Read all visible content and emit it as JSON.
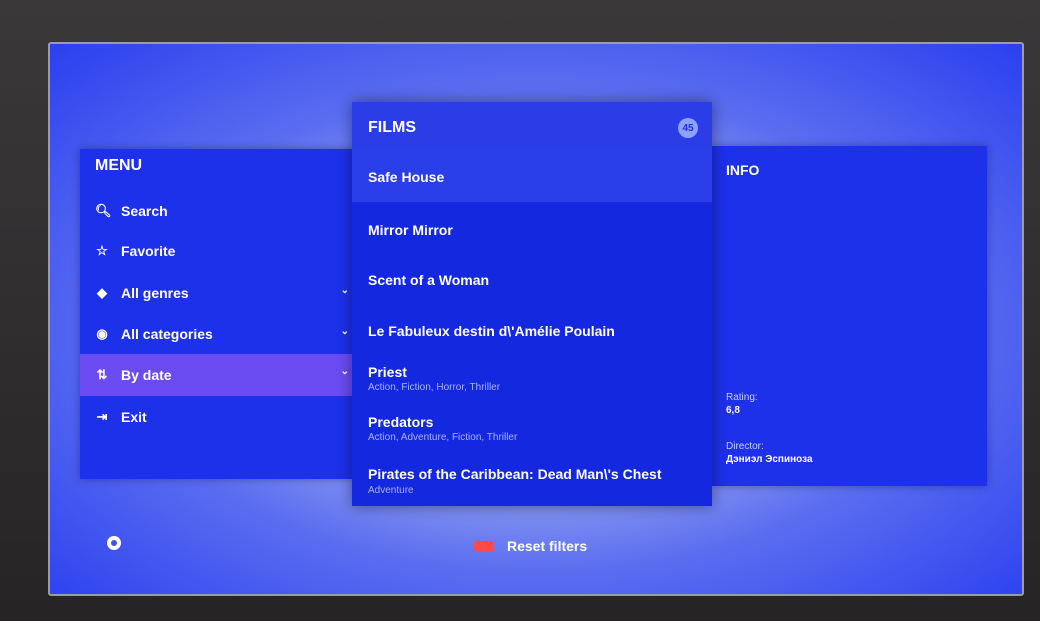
{
  "menu": {
    "title": "MENU",
    "items": [
      {
        "label": "Search",
        "icon": "search-icon",
        "glyph": "🔍︎",
        "chevron": false
      },
      {
        "label": "Favorite",
        "icon": "star-icon",
        "glyph": "☆",
        "chevron": false
      },
      {
        "label": "All genres",
        "icon": "tag-icon",
        "glyph": "◆",
        "chevron": true
      },
      {
        "label": "All categories",
        "icon": "categories-icon",
        "glyph": "◉",
        "chevron": true
      },
      {
        "label": "By date",
        "icon": "sort-icon",
        "glyph": "⇅",
        "chevron": true,
        "active": true
      },
      {
        "label": "Exit",
        "icon": "exit-icon",
        "glyph": "⇥",
        "chevron": false
      }
    ],
    "chevron_glyph": "⌄"
  },
  "films": {
    "title": "FILMS",
    "count": "45",
    "items": [
      {
        "title": "Safe House",
        "genres": ""
      },
      {
        "title": "Mirror Mirror",
        "genres": ""
      },
      {
        "title": "Scent of a Woman",
        "genres": ""
      },
      {
        "title": "Le Fabuleux destin d\\'Amélie Poulain",
        "genres": ""
      },
      {
        "title": "Priest",
        "genres": "Action, Fiction, Horror, Thriller"
      },
      {
        "title": "Predators",
        "genres": "Action, Adventure, Fiction, Thriller"
      },
      {
        "title": "Pirates of the Caribbean: Dead Man\\'s Chest",
        "genres": "Adventure"
      }
    ]
  },
  "info": {
    "title": "INFO",
    "rating_label": "Rating:",
    "rating_value": "6,8",
    "director_label": "Director:",
    "director_value": "Дэниэл Эспиноза"
  },
  "footer": {
    "reset_label": "Reset filters"
  },
  "colors": {
    "active_item": "#6b4cf2",
    "red_key": "#ff4a4a",
    "panel": "#1d30ea"
  }
}
